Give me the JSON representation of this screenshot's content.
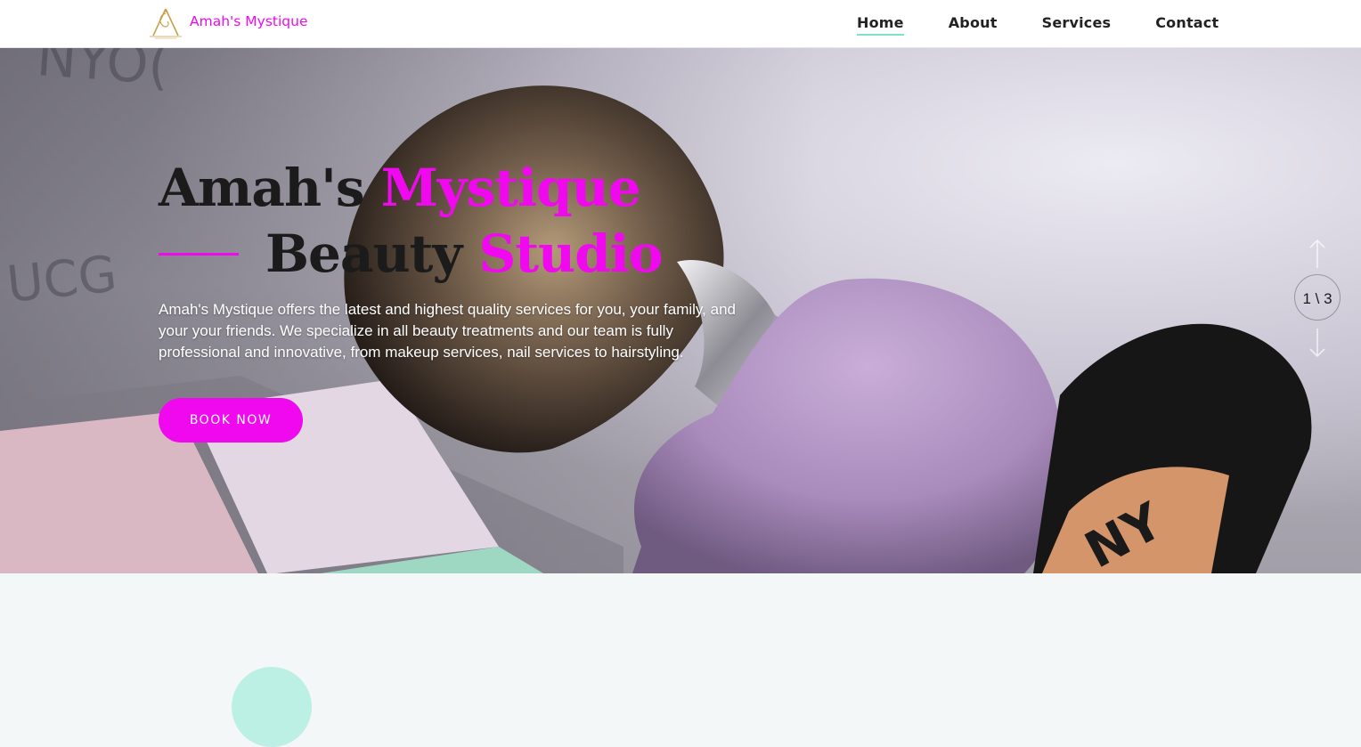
{
  "site": {
    "brand_name": "Amah's Mystique",
    "logo_icon": "salon-logo-icon"
  },
  "nav": {
    "items": [
      {
        "label": "Home",
        "active": true
      },
      {
        "label": "About",
        "active": false
      },
      {
        "label": "Services",
        "active": false
      },
      {
        "label": "Contact",
        "active": false
      }
    ]
  },
  "hero": {
    "title_line1_part1": "Amah's",
    "title_line1_part2": "Mystique",
    "title_line2_part1": "Beauty",
    "title_line2_part2": "Studio",
    "description": "Amah's Mystique offers the latest and highest quality services for you, your family, and your your friends. We specialize in all beauty treatments and our team is fully professional and innovative, from makeup services, nail services to hairstyling.",
    "cta_label": "BOOK NOW",
    "background_image": "makeup-brush-sponge-palette-photo"
  },
  "slider": {
    "current": 1,
    "total": 3,
    "indicator": "1 \\ 3",
    "prev_icon": "arrow-up-icon",
    "next_icon": "arrow-down-icon"
  },
  "colors": {
    "accent": "#f009ee",
    "text_dark": "#1b1b1b",
    "nav_underline": "#2fc9a7",
    "section_bg": "#f4f7f7"
  }
}
